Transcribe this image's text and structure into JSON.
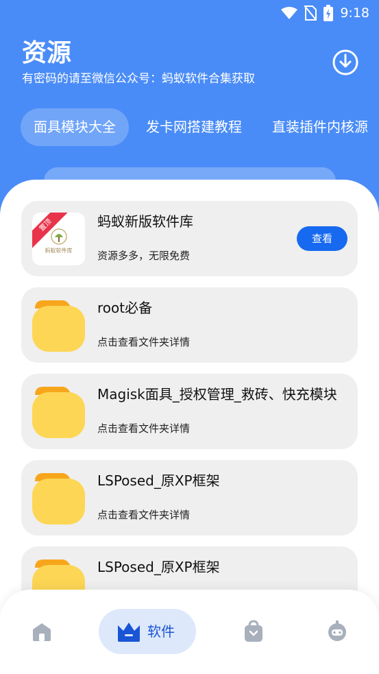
{
  "status_bar": {
    "time": "9:18"
  },
  "header": {
    "title": "资源",
    "subtitle": "有密码的请至微信公众号：蚂蚁软件合集获取"
  },
  "tabs": [
    {
      "label": "面具模块大全",
      "active": true
    },
    {
      "label": "发卡网搭建教程",
      "active": false
    },
    {
      "label": "直装插件内核源",
      "active": false
    }
  ],
  "items": [
    {
      "title": "蚂蚁新版软件库",
      "desc": "资源多多，无限免费",
      "button": "查看",
      "ribbon": "置顶",
      "logo_text": "蚂蚁软件库",
      "icon": "app-logo"
    },
    {
      "title": "root必备",
      "desc": "点击查看文件夹详情",
      "icon": "folder-icon"
    },
    {
      "title": "Magisk面具_授权管理_救砖、快充模块",
      "desc": "点击查看文件夹详情",
      "icon": "folder-icon"
    },
    {
      "title": "LSPosed_原XP框架",
      "desc": "点击查看文件夹详情",
      "icon": "folder-icon"
    },
    {
      "title": "LSPosed_原XP框架",
      "desc": "",
      "icon": "folder-icon"
    }
  ],
  "bottom_nav": {
    "items": [
      {
        "icon": "home-icon"
      },
      {
        "icon": "crown-icon",
        "label": "软件",
        "active": true
      },
      {
        "icon": "bag-icon"
      },
      {
        "icon": "robot-icon"
      }
    ]
  },
  "colors": {
    "primary": "#4a8cf7",
    "button": "#1769f0",
    "folder": "#fdd655",
    "card_bg": "#efefef"
  }
}
